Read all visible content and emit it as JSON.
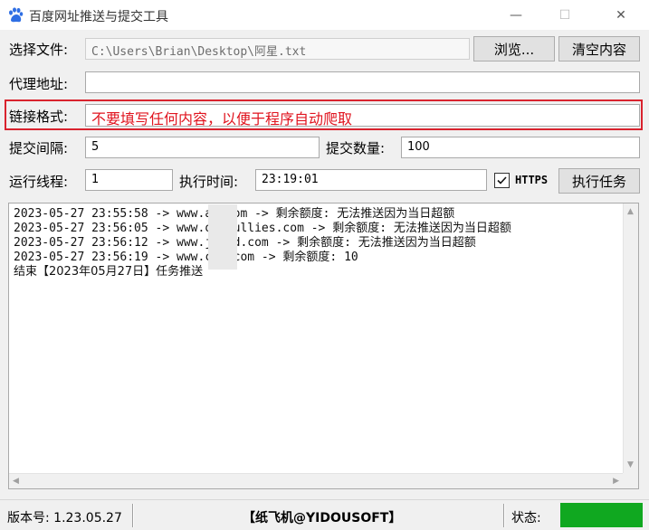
{
  "window": {
    "title": "百度网址推送与提交工具",
    "min_glyph": "—",
    "max_glyph": "☐",
    "close_glyph": "✕"
  },
  "file_row": {
    "label": "选择文件:",
    "path": "C:\\Users\\Brian\\Desktop\\阿星.txt",
    "browse_label": "浏览...",
    "clear_label": "清空内容"
  },
  "proxy_row": {
    "label": "代理地址:",
    "value": ""
  },
  "link_row": {
    "label": "链接格式:",
    "hint": "不要填写任何内容，以便于程序自动爬取"
  },
  "interval_row": {
    "label": "提交间隔:",
    "value": "5",
    "count_label": "提交数量:",
    "count_value": "100"
  },
  "thread_row": {
    "label": "运行线程:",
    "value": "1",
    "time_label": "执行时间:",
    "time_value": "23:19:01",
    "https_label": "HTTPS",
    "https_checked": true,
    "run_label": "执行任务"
  },
  "log": {
    "lines": [
      "2023-05-27 23:55:58 -> www.ac    com -> 剩余额度: 无法推送因为当日超额",
      "2023-05-27 23:56:05 -> www.or   bullies.com -> 剩余额度: 无法推送因为当日超额",
      "2023-05-27 23:56:12 -> www.jb   od.com -> 剩余额度: 无法推送因为当日超额",
      "2023-05-27 23:56:19 -> www.cr   .com -> 剩余额度: 10",
      "结束【2023年05月27日】任务推送"
    ]
  },
  "status": {
    "version": "版本号: 1.23.05.27",
    "credit": "【纸飞机@YIDOUSOFT】",
    "state_label": "状态:",
    "state_color": "#10a820"
  }
}
